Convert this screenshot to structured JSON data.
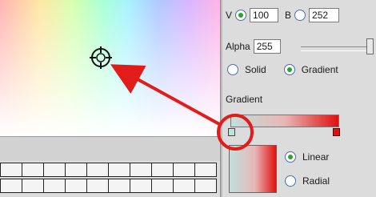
{
  "color_values": {
    "v_label": "V",
    "v_value": "100",
    "b_label": "B",
    "b_value": "252"
  },
  "alpha": {
    "label": "Alpha",
    "value": "255",
    "slider_level": 1.0
  },
  "fill_type": {
    "solid_label": "Solid",
    "gradient_label": "Gradient",
    "selected": "gradient"
  },
  "gradient": {
    "section_label": "Gradient",
    "start_color": "#bfe0dc",
    "end_color": "#e01010"
  },
  "gradient_type": {
    "linear_label": "Linear",
    "radial_label": "Radial",
    "selected": "linear"
  },
  "colors": {
    "annotation_red": "#e21b1b",
    "radio_on": "#2aa52a"
  },
  "icons": {
    "picker": "crosshair-icon",
    "gradient_marker": "gradient-marker-icon"
  }
}
